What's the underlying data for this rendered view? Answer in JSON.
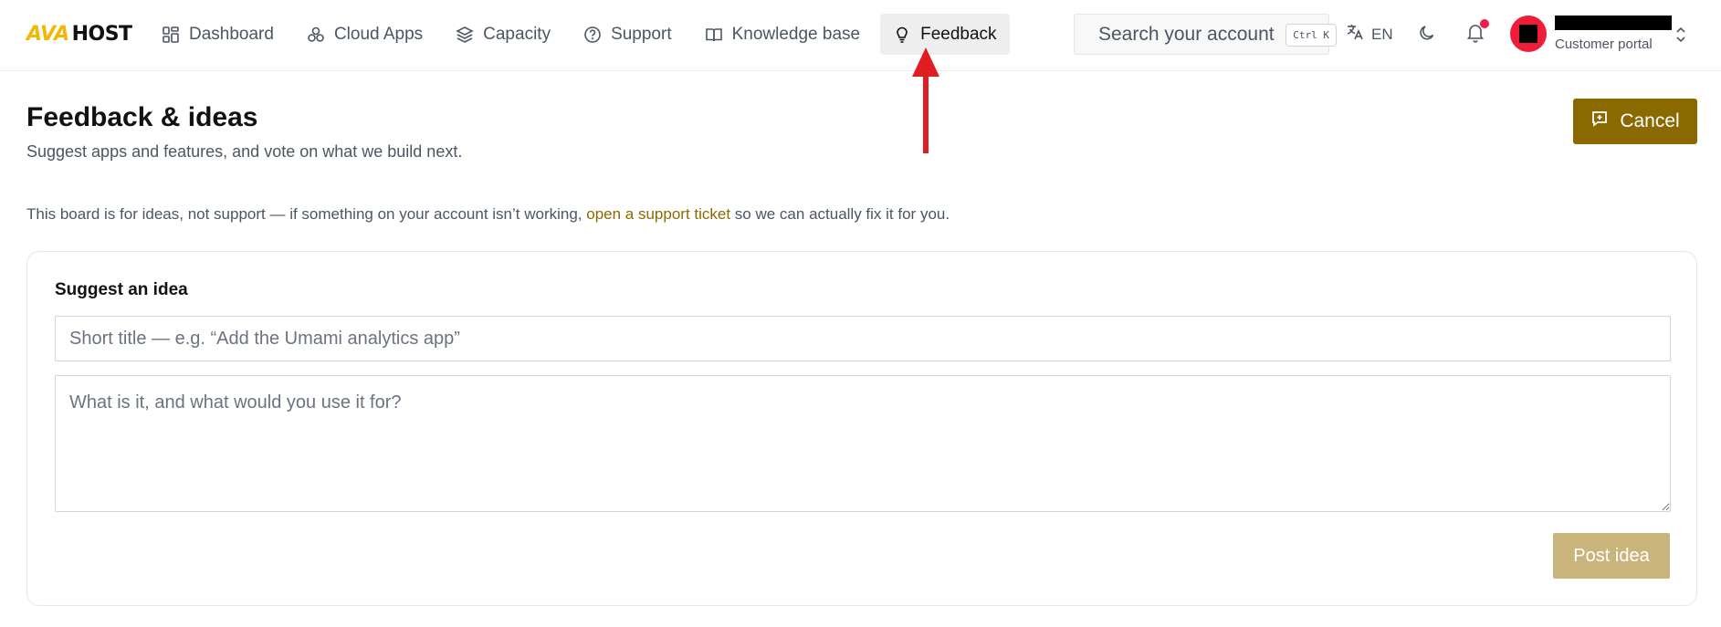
{
  "brand": {
    "logo_ava": "AVA",
    "logo_host": "HOST",
    "accent": "#8a6a00"
  },
  "nav": {
    "items": [
      {
        "label": "Dashboard",
        "icon": "grid-icon"
      },
      {
        "label": "Cloud Apps",
        "icon": "apps-cluster-icon"
      },
      {
        "label": "Capacity",
        "icon": "layers-icon"
      },
      {
        "label": "Support",
        "icon": "help-circle-icon"
      },
      {
        "label": "Knowledge base",
        "icon": "book-icon"
      },
      {
        "label": "Feedback",
        "icon": "lightbulb-icon",
        "active": true
      }
    ]
  },
  "search": {
    "placeholder": "Search your account",
    "shortcut": "Ctrl K"
  },
  "language": {
    "code": "EN"
  },
  "user": {
    "role": "Customer portal"
  },
  "page": {
    "title": "Feedback & ideas",
    "subtitle": "Suggest apps and features, and vote on what we build next.",
    "cancel_label": "Cancel",
    "notice_before": "This board is for ideas, not support — if something on your account isn’t working, ",
    "notice_link": "open a support ticket",
    "notice_after": " so we can actually fix it for you."
  },
  "form": {
    "heading": "Suggest an idea",
    "title_placeholder": "Short title — e.g. “Add the Umami analytics app”",
    "title_value": "",
    "description_placeholder": "What is it, and what would you use it for?",
    "description_value": "",
    "submit_label": "Post idea"
  },
  "colors": {
    "notification_dot": "#ef1c4a",
    "avatar_bg": "#ef1c3a",
    "annotation_arrow": "#e11d24"
  }
}
